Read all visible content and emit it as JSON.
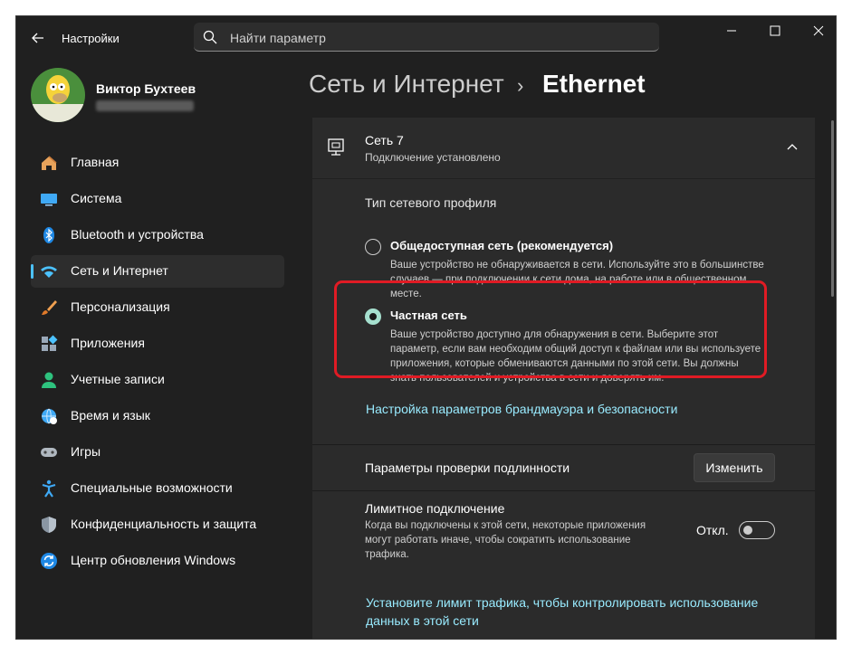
{
  "window": {
    "title": "Настройки",
    "search_placeholder": "Найти параметр"
  },
  "profile": {
    "name": "Виктор Бухтеев"
  },
  "sidebar": {
    "items": [
      {
        "label": "Главная",
        "icon": "home-icon"
      },
      {
        "label": "Система",
        "icon": "system-icon"
      },
      {
        "label": "Bluetooth и устройства",
        "icon": "bluetooth-icon"
      },
      {
        "label": "Сеть и Интернет",
        "icon": "network-wifi-icon",
        "active": true
      },
      {
        "label": "Персонализация",
        "icon": "paintbrush-icon"
      },
      {
        "label": "Приложения",
        "icon": "apps-icon"
      },
      {
        "label": "Учетные записи",
        "icon": "account-icon"
      },
      {
        "label": "Время и язык",
        "icon": "time-language-icon"
      },
      {
        "label": "Игры",
        "icon": "gamepad-icon"
      },
      {
        "label": "Специальные возможности",
        "icon": "accessibility-icon"
      },
      {
        "label": "Конфиденциальность и защита",
        "icon": "shield-icon"
      },
      {
        "label": "Центр обновления Windows",
        "icon": "update-icon"
      }
    ]
  },
  "header": {
    "parent": "Сеть и Интернет",
    "separator": "›",
    "current": "Ethernet"
  },
  "network": {
    "name": "Сеть 7",
    "status": "Подключение установлено"
  },
  "profile_type": {
    "heading": "Тип сетевого профиля",
    "public": {
      "label": "Общедоступная сеть (рекомендуется)",
      "desc1": "Ваше устройство не обнаруживается в сети. Используйте это в большинстве",
      "desc2": "случаев — при подключении к сети дома, на работе или в общественном",
      "desc3": "месте.",
      "selected": false
    },
    "private": {
      "label": "Частная сеть",
      "desc1": "Ваше устройство доступно для обнаружения в сети. Выберите этот",
      "desc2": "параметр, если вам необходим общий доступ к файлам или вы используете",
      "desc3": "приложения, которые обмениваются данными по этой сети. Вы должны",
      "desc4": "знать пользователей и устройства в сети и доверять им.",
      "selected": true
    },
    "firewall_link": "Настройка параметров брандмауэра и безопасности"
  },
  "auth": {
    "label": "Параметры проверки подлинности",
    "button": "Изменить"
  },
  "metered": {
    "label": "Лимитное подключение",
    "desc1": "Когда вы подключены к этой сети, некоторые приложения",
    "desc2": "могут работать иначе, чтобы сократить использование",
    "desc3": "трафика.",
    "state": "Откл.",
    "on": false,
    "link1": "Установите лимит трафика, чтобы контролировать использование",
    "link2": "данных в этой сети"
  },
  "colors": {
    "accent": "#4cc2ff",
    "link": "#99ebff",
    "highlight": "#e01b24"
  }
}
